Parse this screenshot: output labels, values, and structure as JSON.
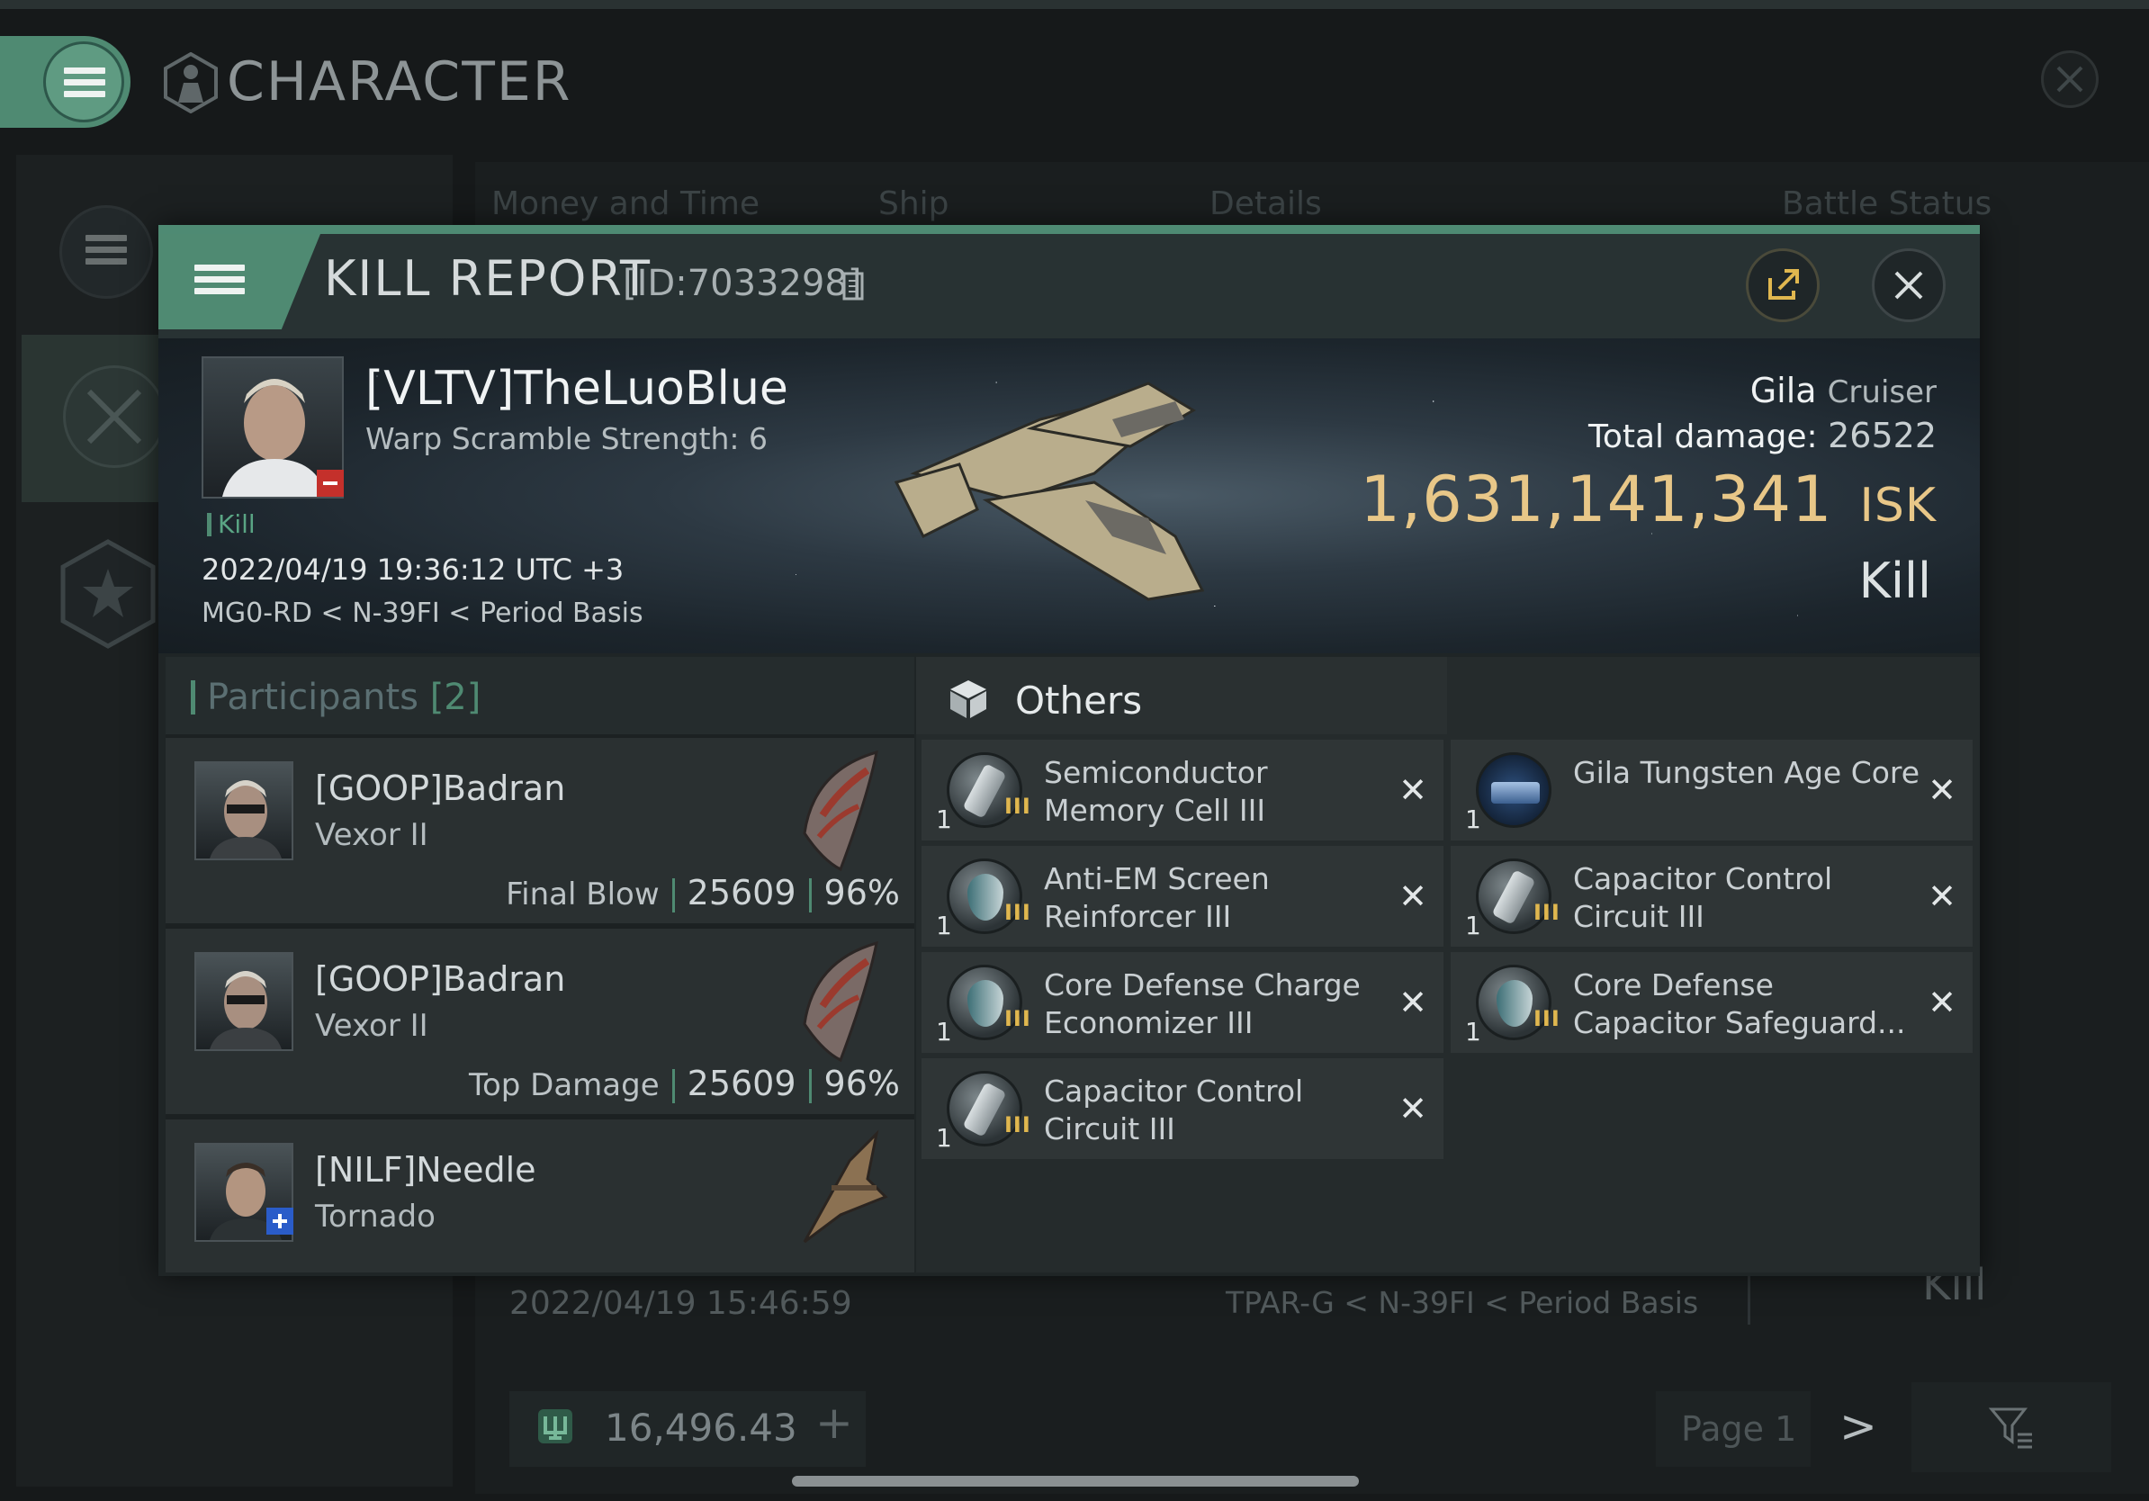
{
  "app": {
    "title": "CHARACTER"
  },
  "background_list": {
    "tabs": [
      "Money and Time",
      "Ship",
      "Details",
      "Battle Status"
    ],
    "row_date": "2022/04/19  15:46:59",
    "row_location": "TPAR-G < N-39FI < Period Basis",
    "row_outcome": "Kill"
  },
  "footer": {
    "wallet_value": "16,496.43",
    "page_label": "Page 1"
  },
  "kill_report": {
    "title": "KILL REPORT",
    "id_label": "[ID:7033298]",
    "victim": {
      "name": "[VLTV]TheLuoBlue",
      "warp_scramble": "Warp Scramble Strength: 6",
      "tag": "Kill",
      "datetime": "2022/04/19 19:36:12 UTC +3",
      "location": "MG0-RD < N-39FI < Period Basis",
      "ship_name": "Gila",
      "ship_class": "Cruiser",
      "total_damage_label": "Total damage:",
      "total_damage_value": "26522",
      "isk_value": "1,631,141,341",
      "isk_unit": "ISK",
      "outcome": "Kill"
    },
    "participants": {
      "title": "Participants",
      "count": "[2]",
      "rows": [
        {
          "name": "[GOOP]Badran",
          "ship": "Vexor II",
          "label": "Final Blow",
          "damage": "25609",
          "percent": "96%"
        },
        {
          "name": "[GOOP]Badran",
          "ship": "Vexor II",
          "label": "Top Damage",
          "damage": "25609",
          "percent": "96%"
        },
        {
          "name": "[NILF]Needle",
          "ship": "Tornado"
        }
      ]
    },
    "items": {
      "section_title": "Others",
      "tier_label": "III",
      "left": [
        {
          "qty": "1",
          "name": "Semiconductor Memory Cell III",
          "icon": "canister-icon"
        },
        {
          "qty": "1",
          "name": "Anti-EM Screen Reinforcer III",
          "icon": "shield-rig-icon"
        },
        {
          "qty": "1",
          "name": "Core Defense Charge Economizer III",
          "icon": "shield-rig-icon"
        },
        {
          "qty": "1",
          "name": "Capacitor Control Circuit III",
          "icon": "canister-icon"
        }
      ],
      "right": [
        {
          "qty": "1",
          "name": "Gila Tungsten Age Core",
          "icon": "core-icon"
        },
        {
          "qty": "1",
          "name": "Capacitor Control Circuit III",
          "icon": "canister-icon"
        },
        {
          "qty": "1",
          "name": "Core Defense Capacitor Safeguard...",
          "icon": "shield-rig-icon"
        }
      ]
    }
  },
  "colors": {
    "accent": "#4f8a72",
    "isk": "#e8c788",
    "tier": "#e0b74f"
  }
}
